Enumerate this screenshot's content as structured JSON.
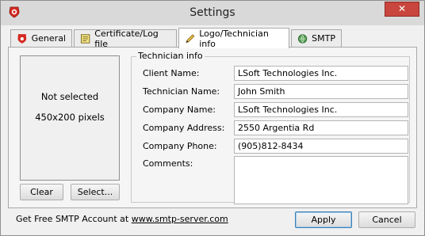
{
  "window": {
    "title": "Settings",
    "close_glyph": "✕",
    "app_icon": "app-logo-icon"
  },
  "tabs": [
    {
      "label": "General",
      "icon": "general-icon"
    },
    {
      "label": "Certificate/Log file",
      "icon": "certificate-icon"
    },
    {
      "label": "Logo/Technician info",
      "icon": "pencil-icon",
      "active": true
    },
    {
      "label": "SMTP",
      "icon": "smtp-icon"
    }
  ],
  "logo": {
    "line1": "Not selected",
    "line2": "450x200 pixels"
  },
  "logo_buttons": {
    "clear": "Clear",
    "select": "Select..."
  },
  "technician": {
    "group_title": "Technician info",
    "fields": [
      {
        "label": "Client Name:",
        "value": "LSoft Technologies Inc."
      },
      {
        "label": "Technician Name:",
        "value": "John Smith"
      },
      {
        "label": "Company Name:",
        "value": "LSoft Technologies Inc."
      },
      {
        "label": "Company Address:",
        "value": "2550 Argentia Rd"
      },
      {
        "label": "Company Phone:",
        "value": "(905)812-8434"
      },
      {
        "label": "Comments:",
        "value": ""
      }
    ]
  },
  "footer": {
    "text": "Get Free SMTP Account at ",
    "link": "www.smtp-server.com",
    "apply": "Apply",
    "cancel": "Cancel"
  }
}
